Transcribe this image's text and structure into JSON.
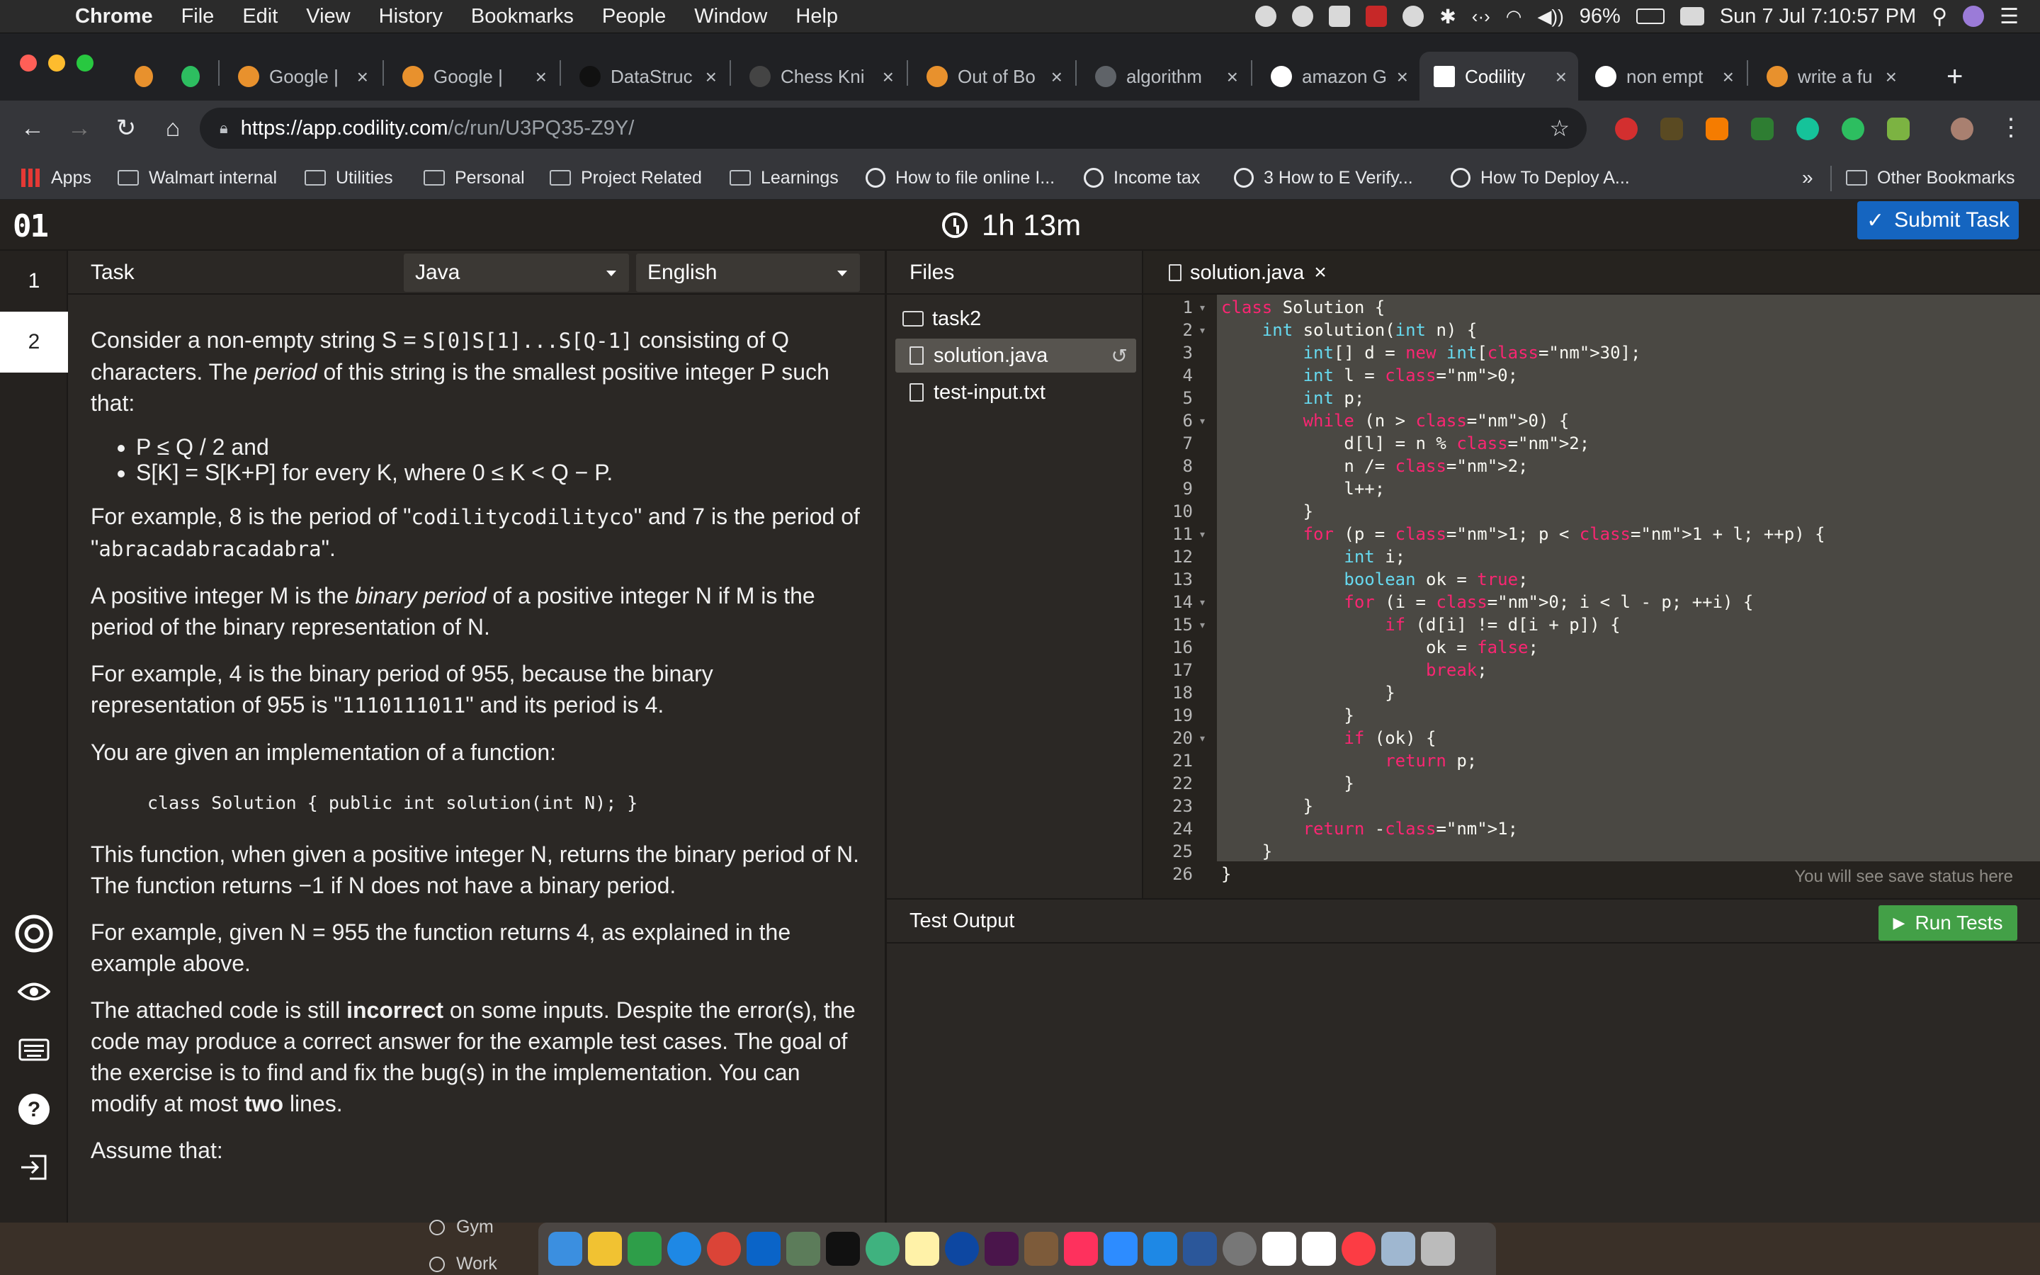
{
  "menubar": {
    "app": "Chrome",
    "items": [
      "File",
      "Edit",
      "View",
      "History",
      "Bookmarks",
      "People",
      "Window",
      "Help"
    ],
    "battery": "96%",
    "datetime": "Sun 7 Jul  7:10:57 PM"
  },
  "tabs": [
    {
      "label": "Google | "
    },
    {
      "label": "Google | "
    },
    {
      "label": "DataStruc"
    },
    {
      "label": "Chess Kni"
    },
    {
      "label": "Out of Bo"
    },
    {
      "label": "algorithm"
    },
    {
      "label": "amazon G"
    },
    {
      "label": "Codility",
      "active": true
    },
    {
      "label": "non empt"
    },
    {
      "label": "write a fu"
    }
  ],
  "url": {
    "host": "https://app.codility.com",
    "path": "/c/run/U3PQ35-Z9Y/"
  },
  "bookmarks": [
    "Apps",
    "Walmart internal",
    "Utilities",
    "Personal",
    "Project Related",
    "Learnings",
    "How to file online I...",
    "Income tax",
    "3 How to E Verify...",
    "How To Deploy A..."
  ],
  "bookmarks_more": "»",
  "other_bookmarks": "Other Bookmarks",
  "app": {
    "logo": "01",
    "timer": "1h 13m",
    "submit": "Submit Task",
    "nav": [
      "1",
      "2"
    ],
    "task_title": "Task",
    "language": "Java",
    "human_language": "English",
    "files_title": "Files",
    "folder": "task2",
    "files": [
      "solution.java",
      "test-input.txt"
    ],
    "editor_tab": "solution.java",
    "save_status": "You will see save status here",
    "test_output": "Test Output",
    "run_tests": "Run Tests"
  },
  "task": {
    "p1a": "Consider a non-empty string S = ",
    "p1code": "S[0]S[1]...S[Q-1]",
    "p1b": " consisting of Q characters. The ",
    "p1em": "period",
    "p1c": " of this string is the smallest positive integer P such that:",
    "li1": "P ≤ Q / 2 and",
    "li2": "S[K] = S[K+P] for every K, where 0 ≤ K < Q − P.",
    "p2a": "For example, 8 is the period of \"",
    "p2code1": "codilitycodilityco",
    "p2b": "\" and 7 is the period of \"",
    "p2code2": "abracadabracadabra",
    "p2c": "\".",
    "p3a": "A positive integer M is the ",
    "p3em": "binary period",
    "p3b": " of a positive integer N if M is the period of the binary representation of N.",
    "p4a": "For example, 4 is the binary period of 955, because the binary representation of 955 is \"",
    "p4code": "1110111011",
    "p4b": "\" and its period is 4.",
    "p5": "You are given an implementation of a function:",
    "sig": "class Solution { public int solution(int N); }",
    "p6": "This function, when given a positive integer N, returns the binary period of N. The function returns −1 if N does not have a binary period.",
    "p7": "For example, given N = 955 the function returns 4, as explained in the example above.",
    "p8a": "The attached code is still ",
    "p8b": "incorrect",
    "p8c": " on some inputs. Despite the error(s), the code may produce a correct answer for the example test cases. The goal of the exercise is to find and fix the bug(s) in the implementation. You can modify at most ",
    "p8d": "two",
    "p8e": " lines.",
    "p9": "Assume that:"
  },
  "code": [
    "class Solution {",
    "    int solution(int n) {",
    "        int[] d = new int[30];",
    "        int l = 0;",
    "        int p;",
    "        while (n > 0) {",
    "            d[l] = n % 2;",
    "            n /= 2;",
    "            l++;",
    "        }",
    "        for (p = 1; p < 1 + l; ++p) {",
    "            int i;",
    "            boolean ok = true;",
    "            for (i = 0; i < l - p; ++i) {",
    "                if (d[i] != d[i + p]) {",
    "                    ok = false;",
    "                    break;",
    "                }",
    "            }",
    "            if (ok) {",
    "                return p;",
    "            }",
    "        }",
    "        return -1;",
    "    }",
    "}"
  ],
  "desktop": {
    "gym": "Gym",
    "work": "Work"
  },
  "colors": {
    "accent_blue": "#1565c0",
    "run_green": "#43a047",
    "editor_bg": "#4a4843",
    "panel_bg": "#2b2825"
  }
}
